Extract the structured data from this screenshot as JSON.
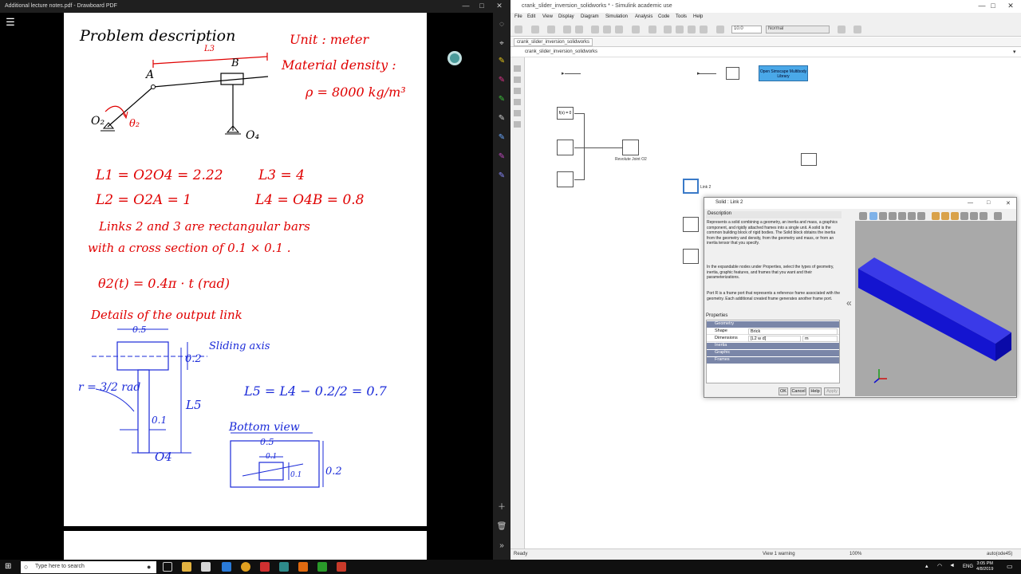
{
  "pdf": {
    "window_title": "Additional lecture notes.pdf - Drawboard PDF",
    "menu_icon": "hamburger-menu-icon",
    "page": {
      "problem_title": "Problem description",
      "unit": "Unit : meter",
      "material_density": "Material density :",
      "rho": "ρ = 8000 kg/m³",
      "label_L3": "L3",
      "label_A": "A",
      "label_B": "B",
      "label_O2": "O₂",
      "label_theta2": "θ₂",
      "label_O4": "O₄",
      "eq_L1": "L1 = O2O4 = 2.22",
      "eq_L3": "L3 = 4",
      "eq_L2": "L2 = O2A = 1",
      "eq_L4": "L4 = O4B = 0.8",
      "links_line1": "Links 2 and 3 are rectangular bars",
      "links_line2": "with a cross section of 0.1 × 0.1 .",
      "theta_eq": "θ2(t) = 0.4π · t   (rad)",
      "details": "Details of the output link",
      "dim_05_top": "0.5",
      "sliding_axis": "Sliding axis",
      "dim_02": "0.2",
      "r_eq": "r = 3/2 rad",
      "L5": "L5",
      "dim_01": "0.1",
      "L5_eq": "L5 = L4 − 0.2/2 = 0.7",
      "label_O4_bottom": "O4",
      "bottom_view": "Bottom view",
      "bv_05": "0.5",
      "bv_01_top": "0.1",
      "bv_01_side": "0.1",
      "bv_02": "0.2"
    }
  },
  "simulink": {
    "window_title": "crank_slider_inversion_solidworks * - Simulink academic use",
    "menu": [
      "File",
      "Edit",
      "View",
      "Display",
      "Diagram",
      "Simulation",
      "Analysis",
      "Code",
      "Tools",
      "Help"
    ],
    "stop_time": "10.0",
    "sim_mode": "Normal",
    "tab": "crank_slider_inversion_solidworks",
    "breadcrumb": "crank_slider_inversion_solidworks",
    "blocks": {
      "fx": "f(x) = 0",
      "revolute": "Revolute Joint O2",
      "link2": "Link 2",
      "open_lib": "Open Simscape Multibody Library"
    },
    "status": {
      "ready": "Ready",
      "view": "View 1 warning",
      "zoom": "100%",
      "solver": "auto(ode45)"
    }
  },
  "dialog": {
    "title": "Solid : Link 2",
    "description_header": "Description",
    "desc1": "Represents a solid combining a geometry, an inertia and mass, a graphics component, and rigidly attached frames into a single unit. A solid is the common building block of rigid bodies. The Solid block obtains the inertia from the geometry and density, from the geometry and mass, or from an inertia tensor that you specify.",
    "desc2": "In the expandable nodes under Properties, select the types of geometry, inertia, graphic features, and frames that you want and their parameterizations.",
    "desc3": "Port R is a frame port that represents a reference frame associated with the geometry. Each additional created frame generates another frame port.",
    "properties_header": "Properties",
    "geometry": "Geometry",
    "shape_label": "Shape",
    "shape_value": "Brick",
    "dimensions_label": "Dimensions",
    "dimensions_value": "[L2 w d]",
    "dimensions_unit": "m",
    "inertia": "Inertia",
    "graphic": "Graphic",
    "frames": "Frames",
    "ok": "OK",
    "cancel": "Cancel",
    "help": "Help",
    "apply": "Apply"
  },
  "taskbar": {
    "search_placeholder": "Type here to search",
    "lang": "ENG",
    "time": "3:05 PM",
    "date": "4/8/2019"
  },
  "colors": {
    "ink_black": "#000000",
    "ink_red": "#e00000",
    "ink_blue": "#1a2ad8",
    "brick": "#1414d0",
    "simscape_block": "#4aa8e8"
  }
}
